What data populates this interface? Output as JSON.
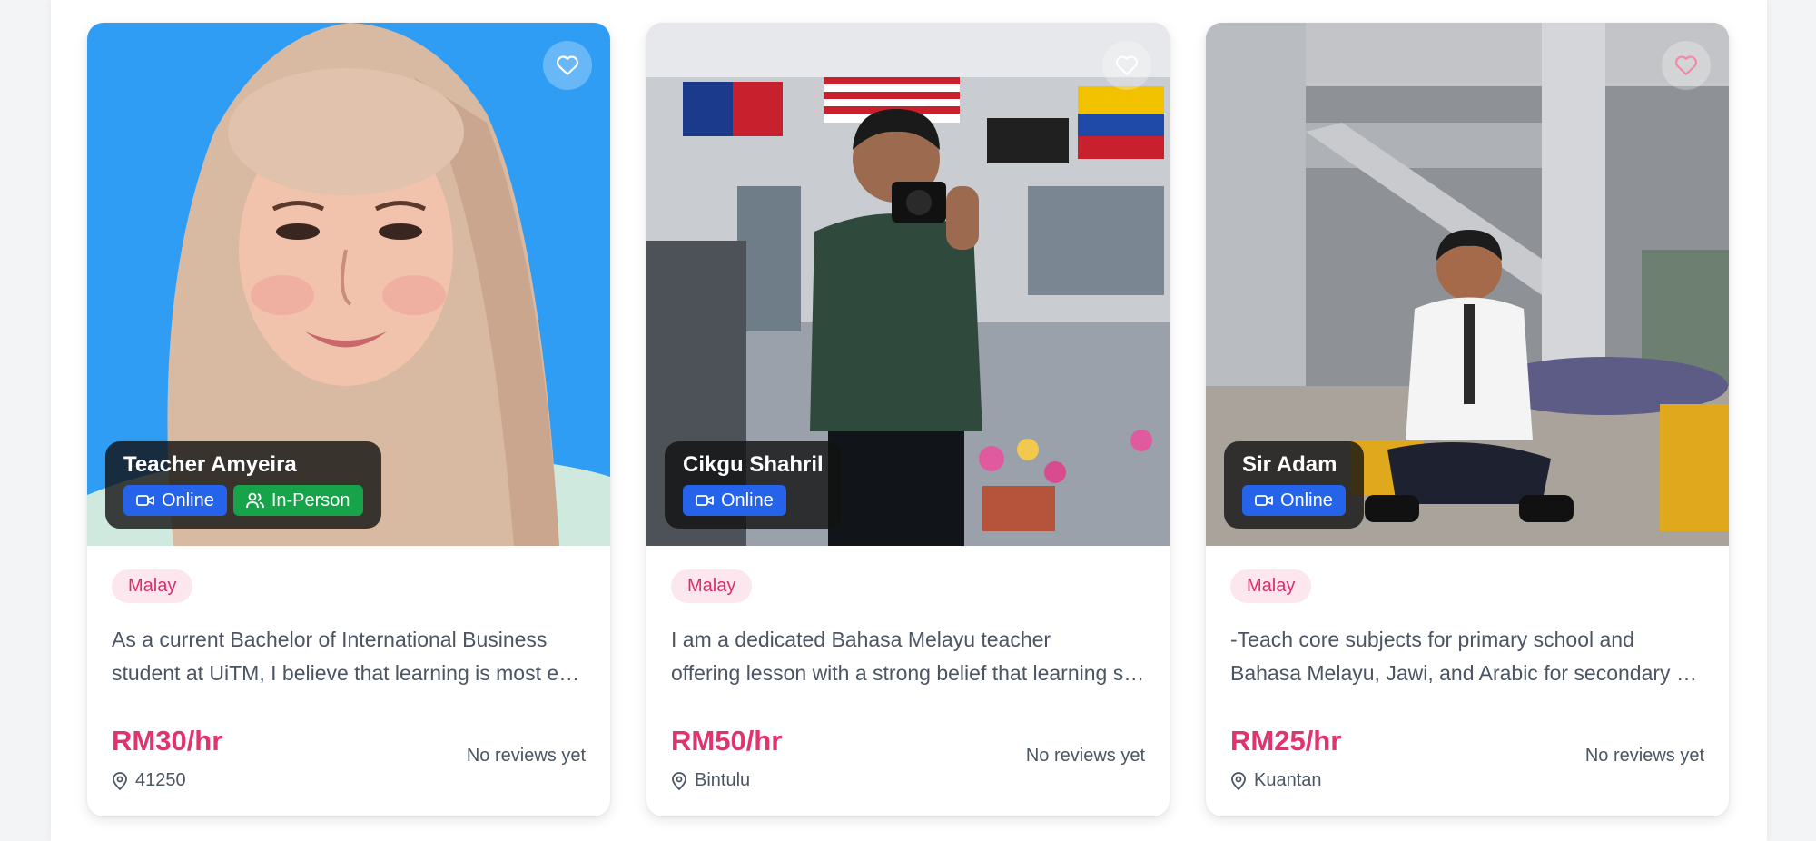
{
  "colors": {
    "price": "#e0336f",
    "lang_badge_bg": "#fce7ef",
    "lang_badge_text": "#db2f6b",
    "online_badge": "#2563eb",
    "inperson_badge": "#16a34a"
  },
  "tutors": [
    {
      "name": "Teacher Amyeira",
      "modes": [
        "Online",
        "In-Person"
      ],
      "language": "Malay",
      "description_lines": [
        "As a current Bachelor of International Business",
        "student at UiTM, I believe that learning is most easy and fun"
      ],
      "price": "RM30/hr",
      "location": "41250",
      "reviews": "No reviews yet",
      "favorite_icon": "heart-icon",
      "location_icon": "map-pin-icon"
    },
    {
      "name": "Cikgu Shahril",
      "modes": [
        "Online"
      ],
      "language": "Malay",
      "description_lines": [
        "I am a dedicated Bahasa Melayu teacher",
        "offering lesson with a strong belief that learning should be fun"
      ],
      "price": "RM50/hr",
      "location": "Bintulu",
      "reviews": "No reviews yet",
      "favorite_icon": "heart-icon",
      "location_icon": "map-pin-icon"
    },
    {
      "name": "Sir Adam",
      "modes": [
        "Online"
      ],
      "language": "Malay",
      "description_lines": [
        "-Teach core subjects for primary school and",
        "Bahasa Melayu, Jawi, and Arabic for secondary school students"
      ],
      "price": "RM25/hr",
      "location": "Kuantan",
      "reviews": "No reviews yet",
      "favorite_icon": "heart-icon",
      "location_icon": "map-pin-icon"
    }
  ]
}
